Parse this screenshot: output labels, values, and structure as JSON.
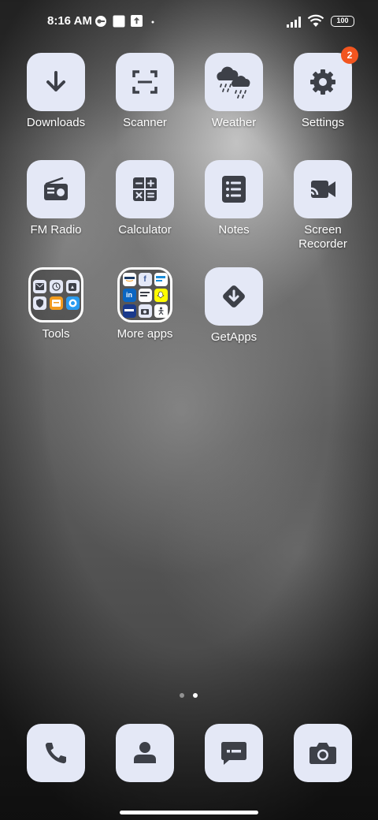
{
  "status_bar": {
    "time": "8:16 AM",
    "battery": "100",
    "icons": [
      "vpn-key-icon",
      "blank-square-notification-icon",
      "upload-notification-icon",
      "dot-icon",
      "signal-icon",
      "wifi-icon",
      "battery-icon"
    ]
  },
  "apps": [
    {
      "label": "Downloads",
      "icon": "download-arrow-icon"
    },
    {
      "label": "Scanner",
      "icon": "scan-frame-icon"
    },
    {
      "label": "Weather",
      "icon": "rain-cloud-icon"
    },
    {
      "label": "Settings",
      "icon": "gear-icon",
      "badge": "2"
    },
    {
      "label": "FM Radio",
      "icon": "radio-icon"
    },
    {
      "label": "Calculator",
      "icon": "calculator-icon"
    },
    {
      "label": "Notes",
      "icon": "list-notes-icon"
    },
    {
      "label": "Screen Recorder",
      "icon": "video-camera-icon"
    },
    {
      "label": "Tools",
      "icon": "folder"
    },
    {
      "label": "More apps",
      "icon": "folder"
    },
    {
      "label": "GetApps",
      "icon": "getapps-diamond-icon"
    }
  ],
  "folders": {
    "tools_minis": [
      "",
      "",
      "",
      "",
      "",
      ""
    ],
    "more_apps_minis": [
      "",
      "f",
      "",
      "in",
      "",
      "",
      "",
      "",
      ""
    ]
  },
  "dock": [
    {
      "icon": "phone-icon"
    },
    {
      "icon": "contacts-icon"
    },
    {
      "icon": "messages-icon"
    },
    {
      "icon": "camera-icon"
    }
  ],
  "colors": {
    "icon_bg": "#e4e8f6",
    "icon_fg": "#3d4048",
    "badge": "#f2551f"
  },
  "pager": {
    "count": 2,
    "active": 2
  }
}
